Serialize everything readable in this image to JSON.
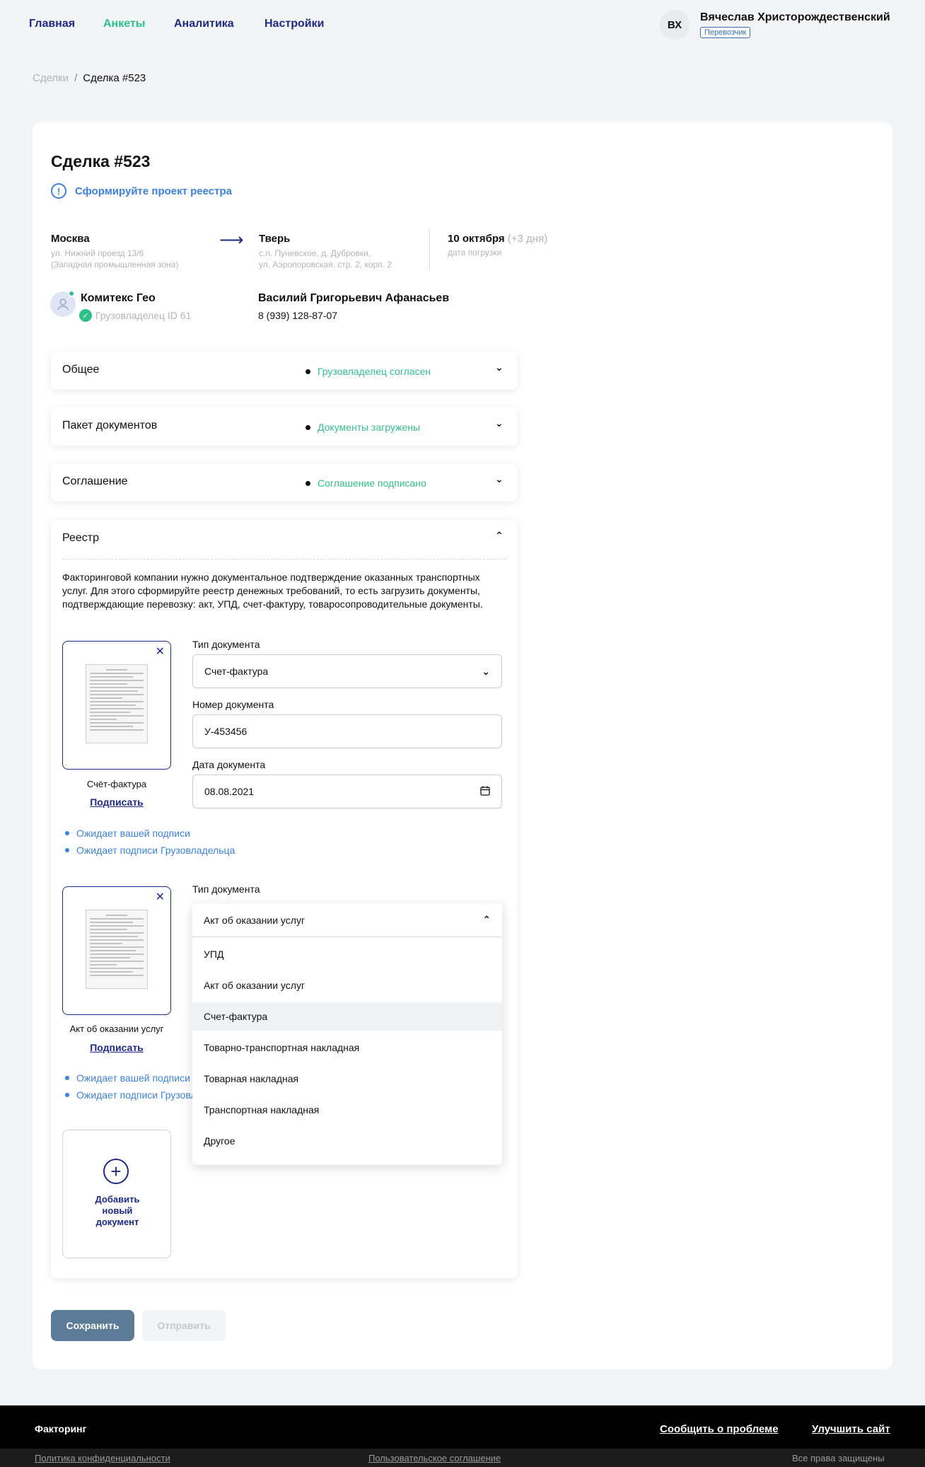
{
  "nav": {
    "items": [
      {
        "label": "Главная",
        "active": false
      },
      {
        "label": "Анкеты",
        "active": true
      },
      {
        "label": "Аналитика",
        "active": false
      },
      {
        "label": "Настройки",
        "active": false
      }
    ]
  },
  "user": {
    "initials": "ВХ",
    "name": "Вячеслав Христорождественский",
    "role": "Перевозчик"
  },
  "breadcrumb": {
    "parent": "Сделки",
    "separator": "/",
    "current": "Сделка #523"
  },
  "deal": {
    "title": "Сделка #523",
    "alert": "Сформируйте проект реестра",
    "from": {
      "city": "Москва",
      "address_line1": "ул. Нижний проезд 13/6",
      "address_line2": "(Западная промышленная зона)"
    },
    "to": {
      "city": "Тверь",
      "address_line1": "с.п. Пуневское, д. Дубровки,",
      "address_line2": "ул. Аэропоровская, стр. 2, корп. 2"
    },
    "load": {
      "date": "10 октября",
      "extra": "(+3 дня)",
      "label": "дата погрузки"
    },
    "company": {
      "name": "Комитекс Гео",
      "role": "Грузовладелец ID 61"
    },
    "contact": {
      "name": "Василий Григорьевич Афанасьев",
      "phone": "8 (939) 128-87-07"
    }
  },
  "accordions": [
    {
      "title": "Общее",
      "status": "Грузовладелец согласен"
    },
    {
      "title": "Пакет документов",
      "status": "Документы загружены"
    },
    {
      "title": "Соглашение",
      "status": "Соглашение подписано"
    }
  ],
  "reestr": {
    "title": "Реестр",
    "description": "Факторинговой компании нужно документальное подтверждение оказанных транспортных услуг. Для этого сформируйте реестр денежных требований, то есть загрузить документы, подтверждающие перевозку: акт, УПД, счет-фактуру, товаросопроводительные документы.",
    "doc1": {
      "caption": "Счёт-фактура",
      "sign": "Подписать",
      "type_label": "Тип документа",
      "type_value": "Счет-фактура",
      "number_label": "Номер документа",
      "number_value": "У-453456",
      "date_label": "Дата документа",
      "date_value": "08.08.2021",
      "status1": "Ожидает вашей подписи",
      "status2": "Ожидает подписи Грузовладельца"
    },
    "doc2": {
      "caption": "Акт об оказании услуг",
      "sign": "Подписать",
      "type_label": "Тип документа",
      "status1": "Ожидает вашей подписи",
      "status2": "Ожидает подписи Грузовладельца"
    },
    "dropdown": {
      "selected": "Акт об оказании услуг",
      "options": [
        "УПД",
        "Акт об оказании услуг",
        "Счет-фактура",
        "Товарно-транспортная накладная",
        "Товарная накладная",
        "Транспортная накладная",
        "Другое"
      ],
      "highlighted": "Счет-фактура"
    },
    "add_doc": "Добавить новый документ"
  },
  "buttons": {
    "save": "Сохранить",
    "send": "Отправить"
  },
  "footer": {
    "brand": "Факторинг",
    "report": "Сообщить о проблеме",
    "improve": "Улучшить сайт",
    "privacy": "Политика конфиденциальности",
    "terms": "Пользовательское соглашение",
    "rights": "Все права защищены"
  },
  "colors": {
    "accent": "#1e2a8a",
    "success": "#2fc08a",
    "info": "#3b82e0",
    "save_button": "#5c7b96"
  }
}
